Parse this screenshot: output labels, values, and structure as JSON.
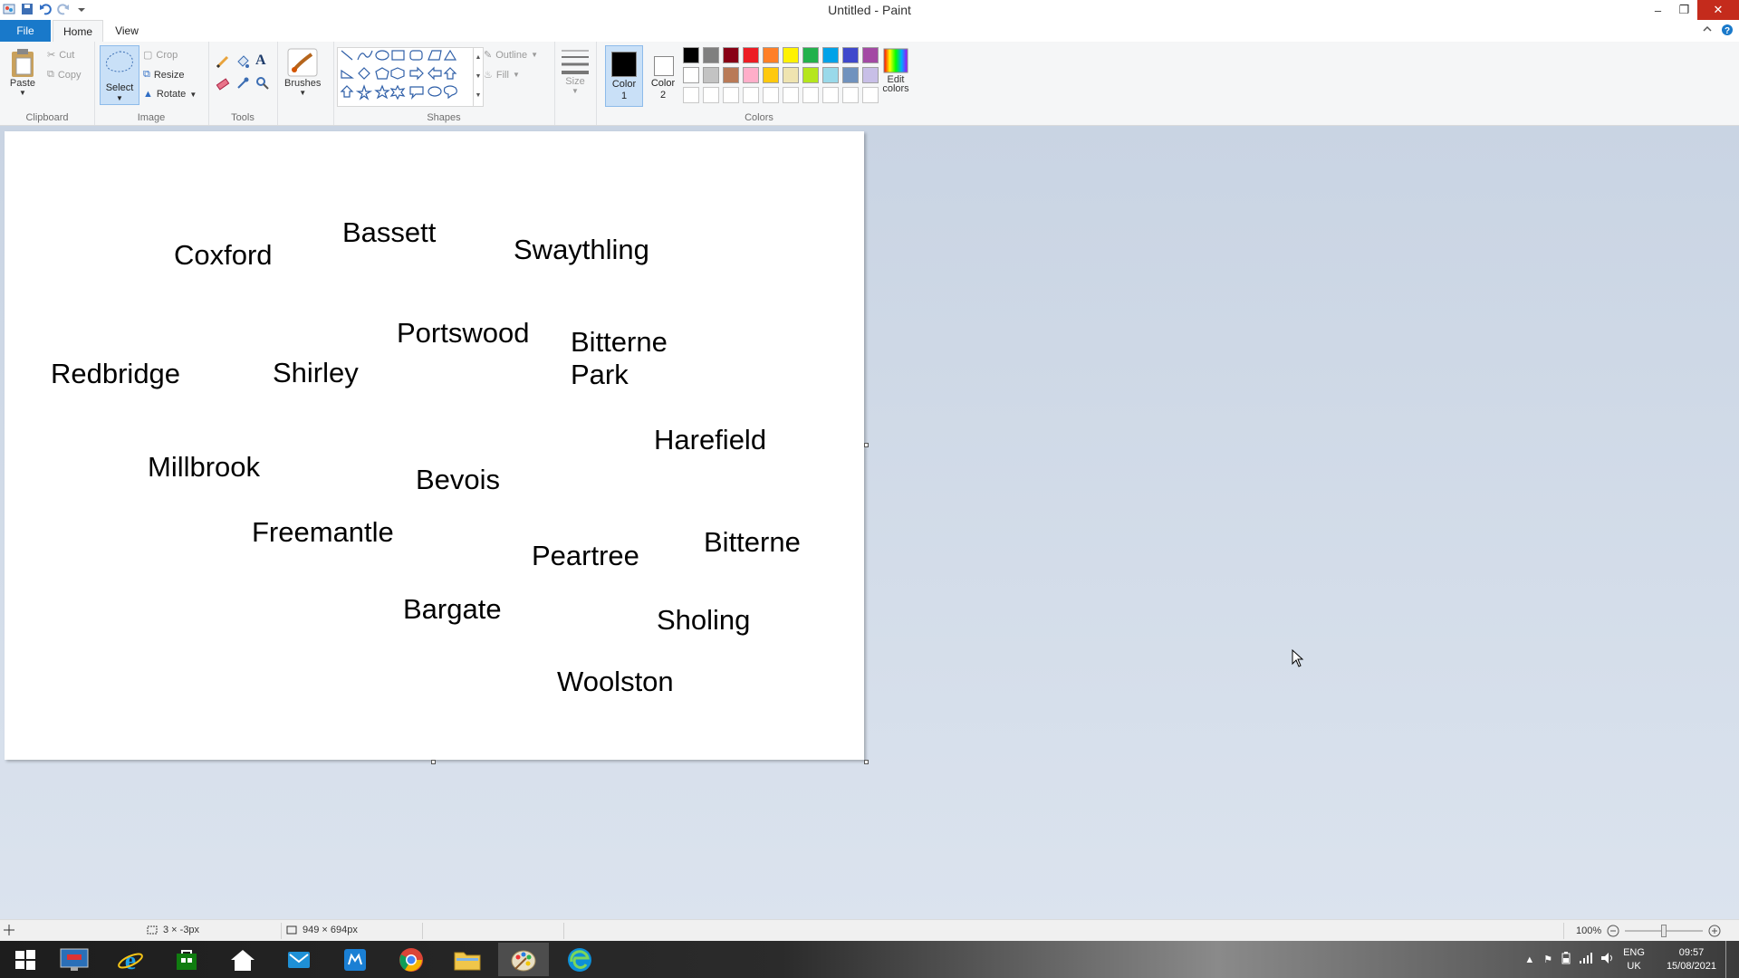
{
  "window": {
    "title": "Untitled - Paint"
  },
  "tabs": {
    "file": "File",
    "home": "Home",
    "view": "View"
  },
  "ribbon": {
    "clipboard": {
      "label": "Clipboard",
      "paste": "Paste",
      "cut": "Cut",
      "copy": "Copy"
    },
    "image": {
      "label": "Image",
      "select": "Select",
      "crop": "Crop",
      "resize": "Resize",
      "rotate": "Rotate"
    },
    "tools": {
      "label": "Tools"
    },
    "brushes": {
      "label": "Brushes"
    },
    "shapes": {
      "label": "Shapes",
      "outline": "Outline",
      "fill": "Fill"
    },
    "size": {
      "label": "Size"
    },
    "color1": {
      "line1": "Color",
      "line2": "1"
    },
    "color2": {
      "line1": "Color",
      "line2": "2"
    },
    "colors": {
      "label": "Colors",
      "edit_line1": "Edit",
      "edit_line2": "colors"
    },
    "palette_row1": [
      "#000000",
      "#7f7f7f",
      "#880015",
      "#ed1c24",
      "#ff7f27",
      "#fff200",
      "#22b14c",
      "#00a2e8",
      "#3f48cc",
      "#a349a4"
    ],
    "palette_row2": [
      "#ffffff",
      "#c3c3c3",
      "#b97a57",
      "#ffaec9",
      "#ffc90e",
      "#efe4b0",
      "#b5e61d",
      "#99d9ea",
      "#7092be",
      "#c8bfe7"
    ],
    "palette_row3": [
      "#ffffff",
      "#ffffff",
      "#ffffff",
      "#ffffff",
      "#ffffff",
      "#ffffff",
      "#ffffff",
      "#ffffff",
      "#ffffff",
      "#ffffff"
    ]
  },
  "canvas_words": [
    {
      "text": "Coxford"
    },
    {
      "text": "Bassett"
    },
    {
      "text": "Swaythling"
    },
    {
      "text": "Portswood"
    },
    {
      "text": "Bitterne"
    },
    {
      "text": "Park"
    },
    {
      "text": "Redbridge"
    },
    {
      "text": "Shirley"
    },
    {
      "text": "Harefield"
    },
    {
      "text": "Millbrook"
    },
    {
      "text": "Bevois"
    },
    {
      "text": "Freemantle"
    },
    {
      "text": "Peartree"
    },
    {
      "text": "Bitterne"
    },
    {
      "text": "Bargate"
    },
    {
      "text": "Sholing"
    },
    {
      "text": "Woolston"
    }
  ],
  "status": {
    "selection": "3 × -3px",
    "canvas_size": "949 × 694px",
    "zoom": "100%"
  },
  "taskbar": {
    "lang1": "ENG",
    "lang2": "UK",
    "time": "09:57",
    "date": "15/08/2021"
  }
}
